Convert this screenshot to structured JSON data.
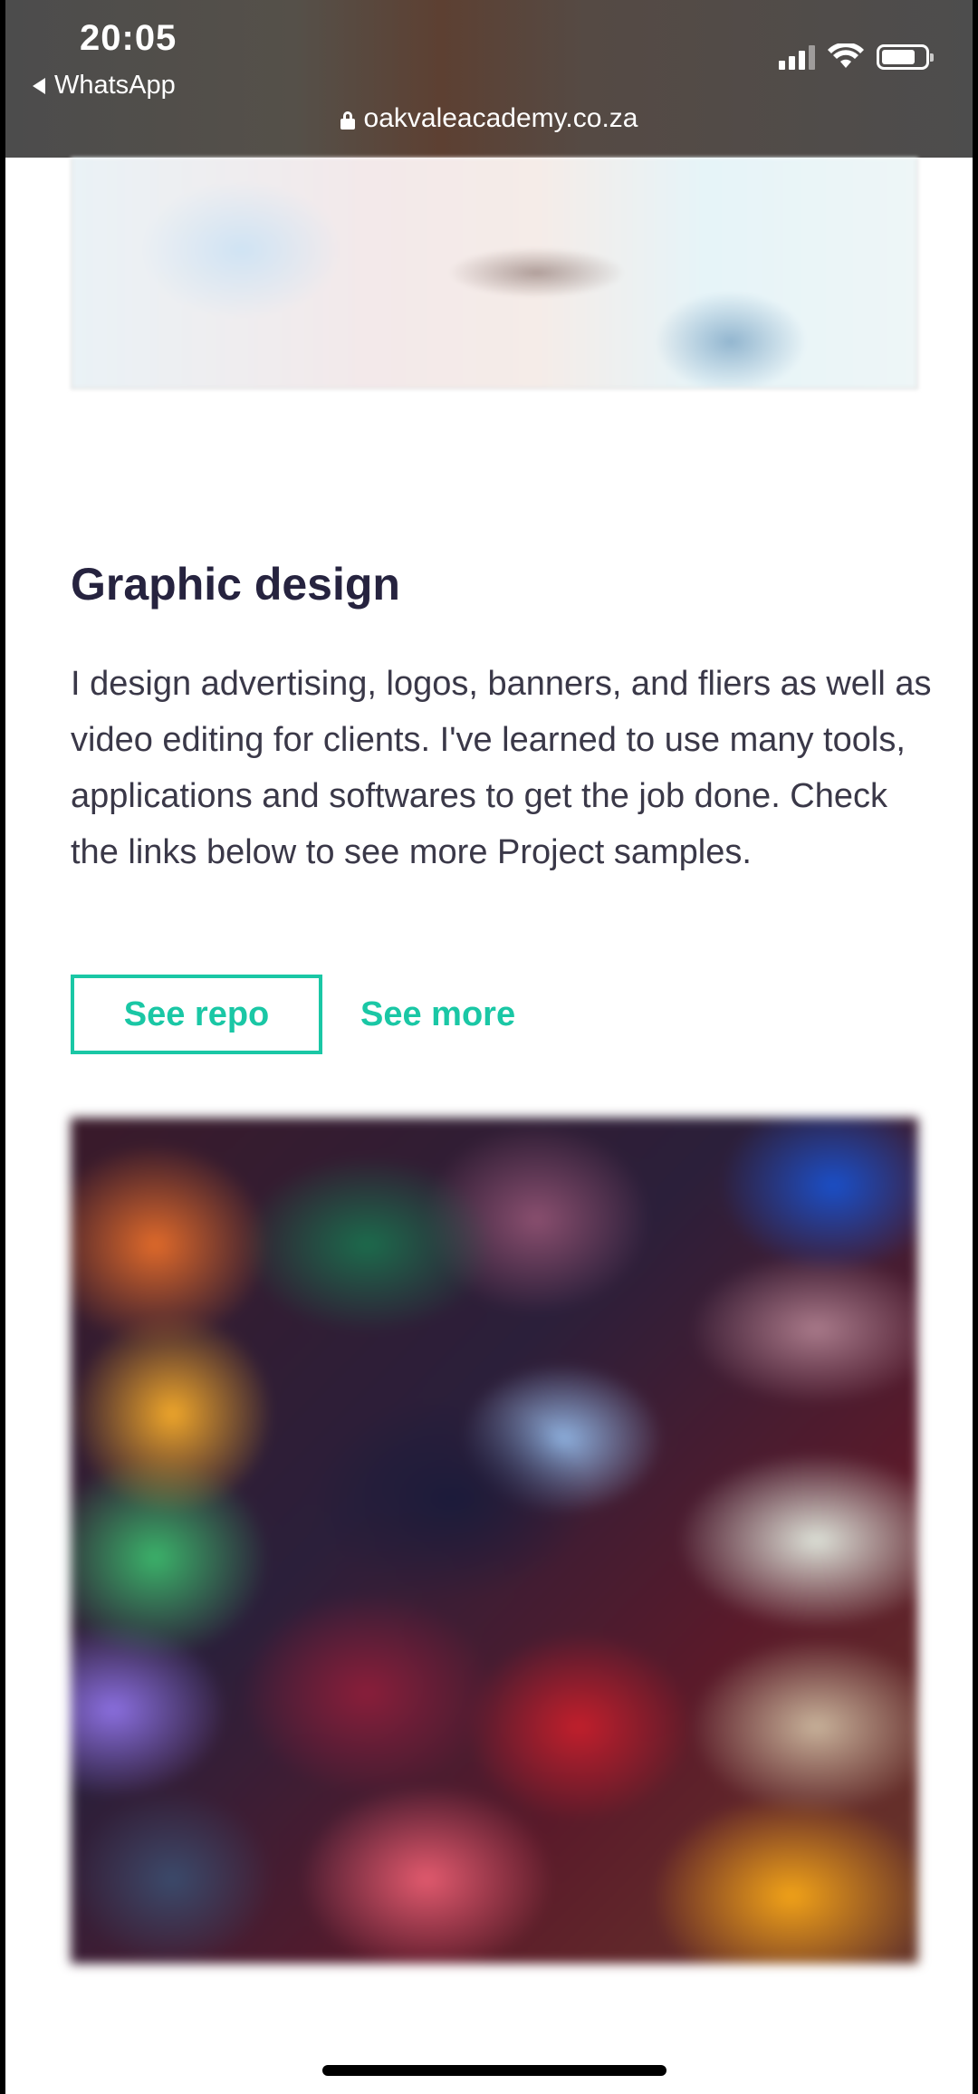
{
  "status_bar": {
    "time": "20:05",
    "back_app": "WhatsApp",
    "url": "oakvaleacademy.co.za"
  },
  "section": {
    "title": "Graphic design",
    "description": "I design advertising, logos, banners, and fliers as well as video editing for clients. I've learned to use many tools, applications and softwares to get the job done. Check the links below to see more Project samples.",
    "primary_button": "See repo",
    "secondary_link": "See more"
  },
  "colors": {
    "accent": "#1ac7a5",
    "heading": "#26233f",
    "body_text": "#3a3848"
  },
  "icons": [
    "back-arrow-icon",
    "signal-icon",
    "wifi-icon",
    "battery-icon",
    "lock-icon"
  ]
}
